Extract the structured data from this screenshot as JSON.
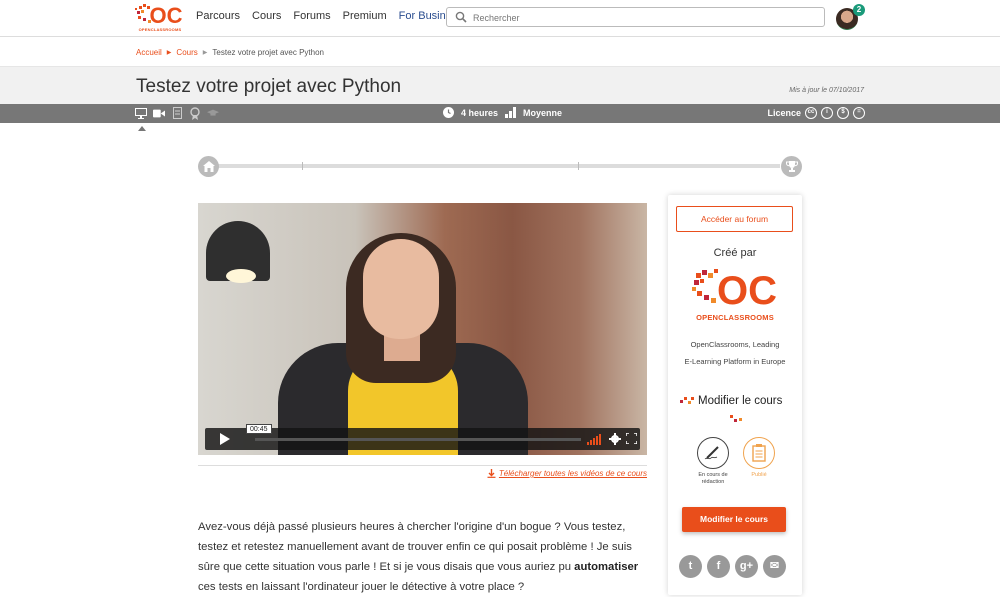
{
  "header": {
    "logo_text": "OPENCLASSROOMS",
    "nav": [
      "Parcours",
      "Cours",
      "Forums",
      "Premium",
      "For Business"
    ],
    "search_placeholder": "Rechercher",
    "notification_count": "2"
  },
  "breadcrumb": {
    "items": [
      "Accueil",
      "Cours",
      "Testez votre projet avec Python"
    ]
  },
  "course": {
    "title": "Testez votre projet avec Python",
    "updated": "Mis à jour le 07/10/2017",
    "duration": "4 heures",
    "level": "Moyenne",
    "license_label": "Licence"
  },
  "video": {
    "time_tooltip": "00:45",
    "progress_fraction": 0.0,
    "download_label": "Télécharger toutes les vidéos de ce cours"
  },
  "intro": {
    "before_bold": "Avez-vous déjà passé plusieurs heures à chercher l'origine d'un bogue ? Vous testez, testez et retestez manuellement avant de trouver enfin ce qui posait problème ! Je suis sûre que cette situation vous parle ! Et si je vous disais que vous auriez pu ",
    "bold": "automatiser",
    "after_bold": " ces tests en laissant l'ordinateur jouer le détective à votre place ?"
  },
  "sidebar": {
    "forum_button": "Accéder au forum",
    "created_by": "Créé par",
    "author_logo_text": "OPENCLASSROOMS",
    "author_desc_line1": "OpenClassrooms, Leading",
    "author_desc_line2": "E-Learning Platform in Europe",
    "modify_heading": "Modifier le cours",
    "step1_label_line1": "En cours de",
    "step1_label_line2": "rédaction",
    "step2_label": "Publié",
    "modify_button": "Modifier le cours",
    "social": [
      "t",
      "f",
      "g+",
      "✉"
    ]
  },
  "colors": {
    "accent": "#e94e1b",
    "infobar": "#777777",
    "business": "#2a4d8f"
  }
}
